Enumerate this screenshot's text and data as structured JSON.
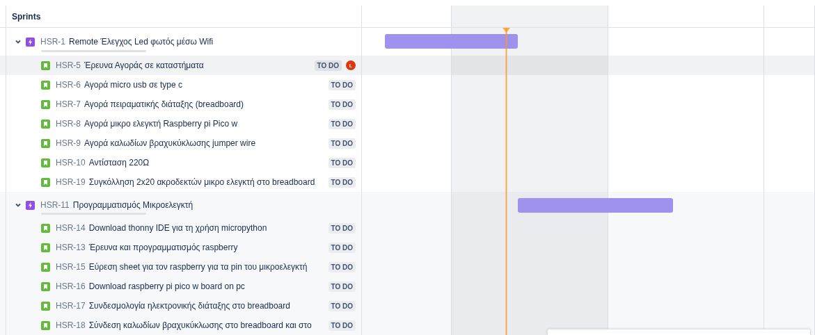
{
  "panel": {
    "header": "Sprints"
  },
  "epics": [
    {
      "key": "HSR-1",
      "title": "Remote Έλεγχος Led φωτός μέσω Wifi",
      "expanded": true,
      "level": 0,
      "children": [
        {
          "key": "HSR-5",
          "title": "Έρευνα Αγοράς σε καταστήματα",
          "status": "TO DO",
          "selected": true,
          "assignee": "L"
        },
        {
          "key": "HSR-6",
          "title": "Αγορά micro usb σε type c",
          "status": "TO DO",
          "selected": false
        },
        {
          "key": "HSR-7",
          "title": "Αγορά πειραματικής διάταξης (breadboard)",
          "status": "TO DO",
          "selected": false
        },
        {
          "key": "HSR-8",
          "title": "Αγορά μικρο ελεγκτή Raspberry pi Pico w",
          "status": "TO DO",
          "selected": false
        },
        {
          "key": "HSR-9",
          "title": "Αγορά καλωδίων βραχυκύκλωσης jumper wire",
          "status": "TO DO",
          "selected": false
        },
        {
          "key": "HSR-10",
          "title": "Αντίσταση 220Ω",
          "status": "TO DO",
          "selected": false
        },
        {
          "key": "HSR-19",
          "title": "Συγκόλληση 2x20 ακροδεκτών μικρο ελεγκτή στο breadboard",
          "status": "TO DO",
          "selected": false
        }
      ]
    },
    {
      "key": "HSR-11",
      "title": "Προγραμματισμός Μικροελεγκτή",
      "expanded": true,
      "level": 0,
      "children": [
        {
          "key": "HSR-14",
          "title": "Download thonny IDE για τη χρήση micropython",
          "status": "TO DO",
          "selected": false
        },
        {
          "key": "HSR-13",
          "title": "Έρευνα και προγραμματισμός raspberry",
          "status": "TO DO",
          "selected": false
        },
        {
          "key": "HSR-15",
          "title": "Εύρεση sheet για τον raspberry για τα pin του μικροελεγκτή",
          "status": "TO DO",
          "selected": false
        },
        {
          "key": "HSR-16",
          "title": "Download raspberry pi pico w board on pc",
          "status": "TO DO",
          "selected": false
        },
        {
          "key": "HSR-17",
          "title": "Συνδεσμολογία ηλεκτρονικής διάταξης στο breadboard",
          "status": "TO DO",
          "selected": false
        },
        {
          "key": "HSR-18",
          "title": "Σύνδεση καλωδίων βραχυκύκλωσης στο breadboard και στο",
          "status": "TO DO",
          "selected": false
        }
      ]
    }
  ]
}
